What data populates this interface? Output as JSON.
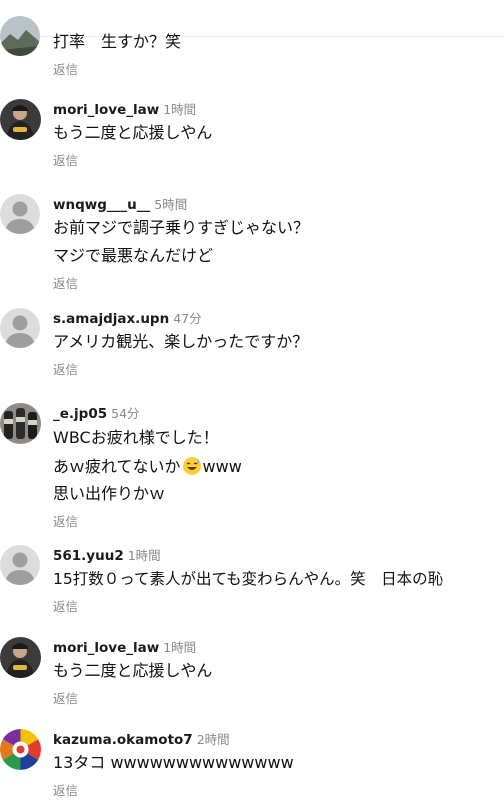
{
  "reply_label": "返信",
  "comments": [
    {
      "avatar": "landscape-photo",
      "lines": [
        "打率　生すか？笑"
      ]
    },
    {
      "username": "mori_love_law",
      "time": "1時間",
      "avatar": "baseball-player-photo",
      "lines": [
        "もう二度と応援しやん"
      ]
    },
    {
      "username": "wnqwg___u__",
      "time": "5時間",
      "avatar": "default-person",
      "lines": [
        "お前マジで調子乗りすぎじゃない？",
        "マジで最悪なんだけど"
      ]
    },
    {
      "username": "s.amajdjax.upn",
      "time": "47分",
      "avatar": "default-person",
      "lines": [
        "アメリカ観光、楽しかったですか？"
      ]
    },
    {
      "username": "_e.jp05",
      "time": "54分",
      "avatar": "bottles-photo",
      "lines": [
        "WBCお疲れ様でした！",
        "あｗ疲れてないか",
        "思い出作りかｗ"
      ],
      "line2_suffix": "www",
      "line2_emoji": "sweat-smile-emoji"
    },
    {
      "username": "561.yuu2",
      "time": "1時間",
      "avatar": "default-person",
      "lines": [
        "15打数０って素人が出ても変わらんやん。笑　日本の恥"
      ]
    },
    {
      "username": "mori_love_law",
      "time": "1時間",
      "avatar": "baseball-player-photo",
      "lines": [
        "もう二度と応援しやん"
      ]
    },
    {
      "username": "kazuma.okamoto7",
      "time": "2時間",
      "avatar": "color-wheel-logo",
      "lines": [
        "13タコ wwwwwwwwwwwwww"
      ]
    }
  ]
}
